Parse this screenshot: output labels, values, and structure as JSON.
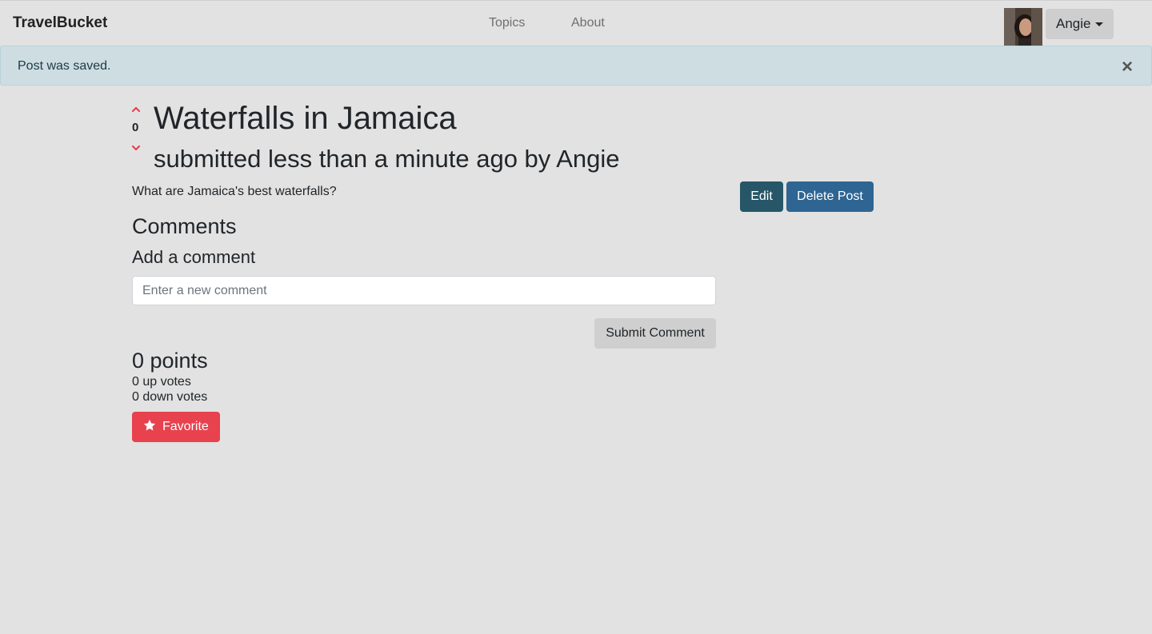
{
  "navbar": {
    "brand": "TravelBucket",
    "links": [
      "Topics",
      "About"
    ],
    "user": "Angie"
  },
  "alert": {
    "message": "Post was saved.",
    "close": "×"
  },
  "post": {
    "vote_count": "0",
    "title": "Waterfalls in Jamaica",
    "meta": "submitted less than a minute ago by Angie",
    "body": "What are Jamaica's best waterfalls?",
    "edit_label": "Edit",
    "delete_label": "Delete Post"
  },
  "comments": {
    "heading": "Comments",
    "add_heading": "Add a comment",
    "placeholder": "Enter a new comment",
    "submit_label": "Submit Comment"
  },
  "stats": {
    "points": "0 points",
    "up_votes": "0 up votes",
    "down_votes": "0 down votes"
  },
  "favorite": {
    "label": "Favorite",
    "icon": "star-icon"
  },
  "colors": {
    "vote_arrow": "#e8424f",
    "favorite": "#e8424f",
    "edit": "#265667",
    "delete": "#2e6592"
  }
}
